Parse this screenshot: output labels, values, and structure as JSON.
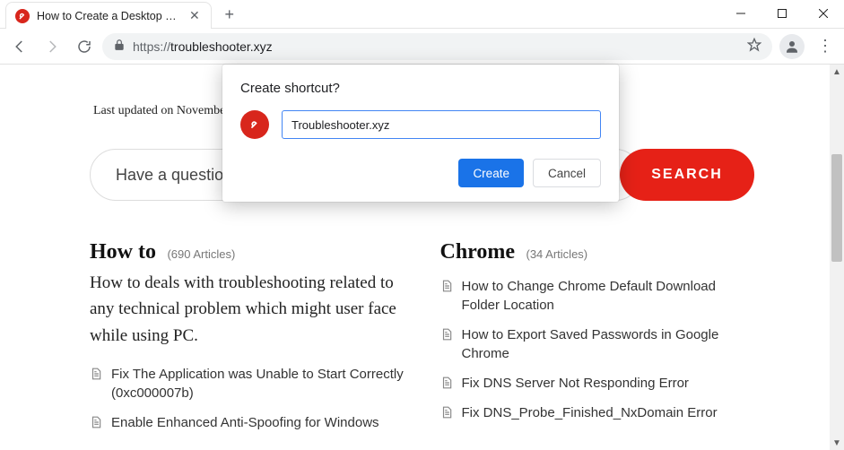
{
  "window": {
    "tab_title": "How to Create a Desktop Shortcu",
    "url_protocol": "https://",
    "url_rest": "troubleshooter.xyz"
  },
  "dialog": {
    "title": "Create shortcut?",
    "input_value": "Troubleshooter.xyz",
    "create_label": "Create",
    "cancel_label": "Cancel"
  },
  "page": {
    "updated": "Last updated on Novembe",
    "search_placeholder": "Have a question",
    "search_button": "SEARCH",
    "howto": {
      "heading": "How to",
      "count": "(690 Articles)",
      "lead": "How to deals with troubleshooting related to any technical problem which might user face while using PC.",
      "items": [
        "Fix The Application was Unable to Start Correctly (0xc000007b)",
        "Enable Enhanced Anti-Spoofing for Windows"
      ]
    },
    "chrome": {
      "heading": "Chrome",
      "count": "(34 Articles)",
      "items": [
        "How to Change Chrome Default Download Folder Location",
        "How to Export Saved Passwords in Google Chrome",
        "Fix DNS Server Not Responding Error",
        "Fix DNS_Probe_Finished_NxDomain Error"
      ]
    }
  }
}
